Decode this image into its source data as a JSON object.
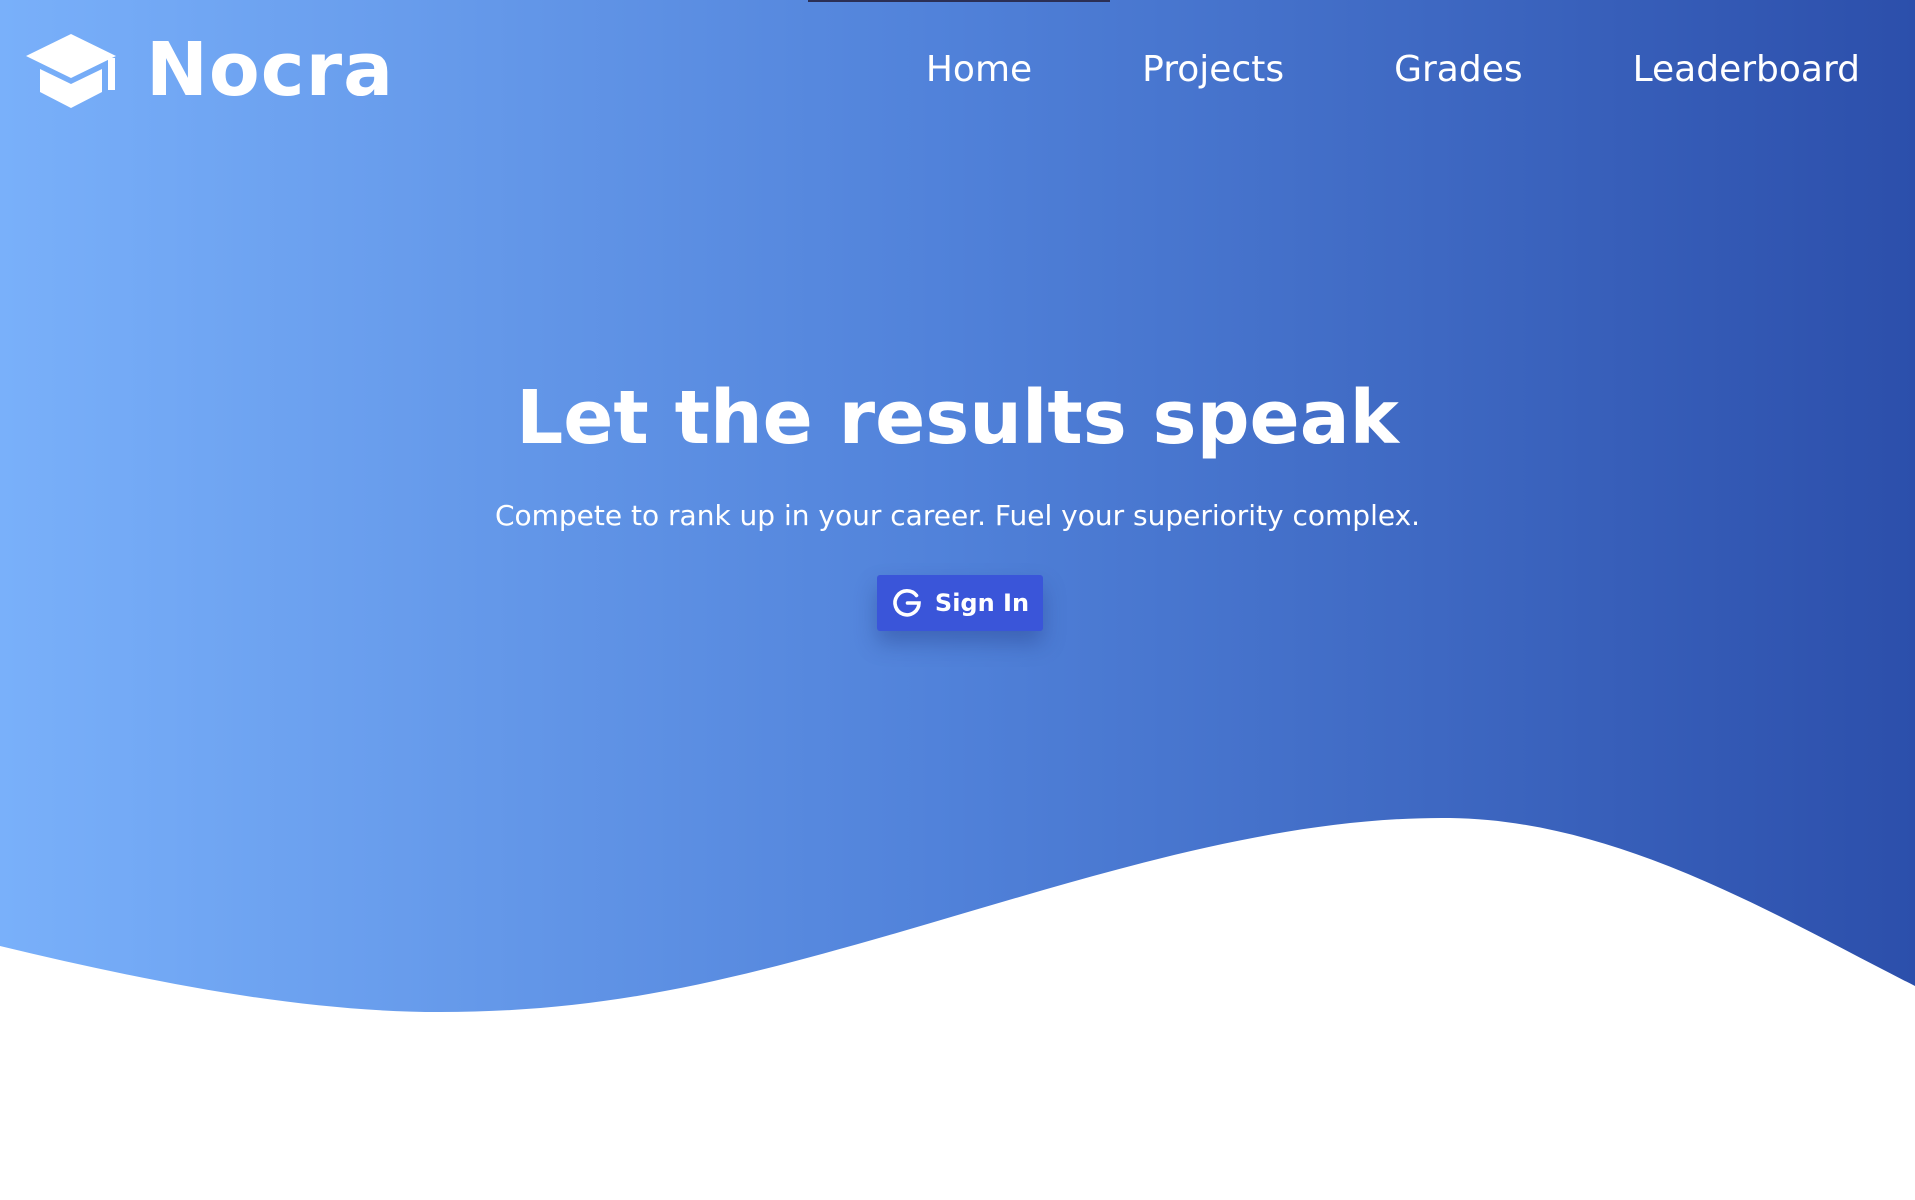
{
  "brand": {
    "name": "Nocra",
    "icon": "graduation-cap-icon"
  },
  "nav": {
    "items": [
      {
        "label": "Home"
      },
      {
        "label": "Projects"
      },
      {
        "label": "Grades"
      },
      {
        "label": "Leaderboard"
      }
    ]
  },
  "hero": {
    "headline": "Let the results speak",
    "subheadline": "Compete to rank up in your career. Fuel your superiority complex.",
    "signin": {
      "label": "Sign In",
      "icon": "google-icon"
    }
  },
  "colors": {
    "gradient_start": "#79b0fa",
    "gradient_end": "#2c4fab",
    "button": "#3a55d9",
    "text": "#ffffff"
  }
}
